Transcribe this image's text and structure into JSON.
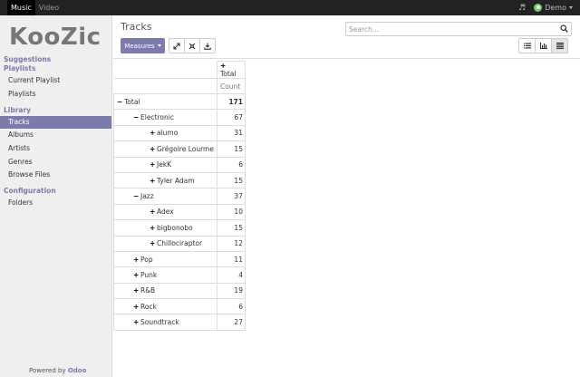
{
  "topbar": {
    "tabs": [
      "Music",
      "Video"
    ],
    "user": "Demo",
    "music_icon": "music-note-icon"
  },
  "sidebar": {
    "logo": "KooZic",
    "sections": [
      {
        "title": "Suggestions",
        "items": []
      },
      {
        "title": "Playlists",
        "items": [
          "Current Playlist",
          "Playlists"
        ]
      },
      {
        "title": "Library",
        "items": [
          "Tracks",
          "Albums",
          "Artists",
          "Genres",
          "Browse Files"
        ]
      },
      {
        "title": "Configuration",
        "items": [
          "Folders"
        ]
      }
    ],
    "active_item": "Tracks",
    "powered_by": "Powered by",
    "powered_brand": "Odoo"
  },
  "main": {
    "title": "Tracks",
    "measures_label": "Measures",
    "search_placeholder": "Search...",
    "toolbar_icons": [
      "expand-icon",
      "fit-icon",
      "download-icon"
    ],
    "view_icons": [
      "list-view-icon",
      "graph-view-icon",
      "pivot-view-icon"
    ],
    "active_view": "pivot"
  },
  "pivot": {
    "col_header": "Total",
    "measure": "Count",
    "rows": [
      {
        "label": "Total",
        "value": "171",
        "sym": "−",
        "level": 0
      },
      {
        "label": "Electronic",
        "value": "67",
        "sym": "−",
        "level": 1
      },
      {
        "label": "alumo",
        "value": "31",
        "sym": "+",
        "level": 2
      },
      {
        "label": "Grégoire Lourme",
        "value": "15",
        "sym": "+",
        "level": 2
      },
      {
        "label": "JekK",
        "value": "6",
        "sym": "+",
        "level": 2
      },
      {
        "label": "Tyler Adam",
        "value": "15",
        "sym": "+",
        "level": 2
      },
      {
        "label": "Jazz",
        "value": "37",
        "sym": "−",
        "level": 1
      },
      {
        "label": "Adex",
        "value": "10",
        "sym": "+",
        "level": 2
      },
      {
        "label": "bigbonobo",
        "value": "15",
        "sym": "+",
        "level": 2
      },
      {
        "label": "Chillociraptor",
        "value": "12",
        "sym": "+",
        "level": 2
      },
      {
        "label": "Pop",
        "value": "11",
        "sym": "+",
        "level": 1
      },
      {
        "label": "Punk",
        "value": "4",
        "sym": "+",
        "level": 1
      },
      {
        "label": "R&B",
        "value": "19",
        "sym": "+",
        "level": 1
      },
      {
        "label": "Rock",
        "value": "6",
        "sym": "+",
        "level": 1
      },
      {
        "label": "Soundtrack",
        "value": "27",
        "sym": "+",
        "level": 1
      }
    ]
  },
  "colors": {
    "accent": "#7c7bad",
    "topbar": "#222222",
    "sidebar": "#f0eeee"
  }
}
